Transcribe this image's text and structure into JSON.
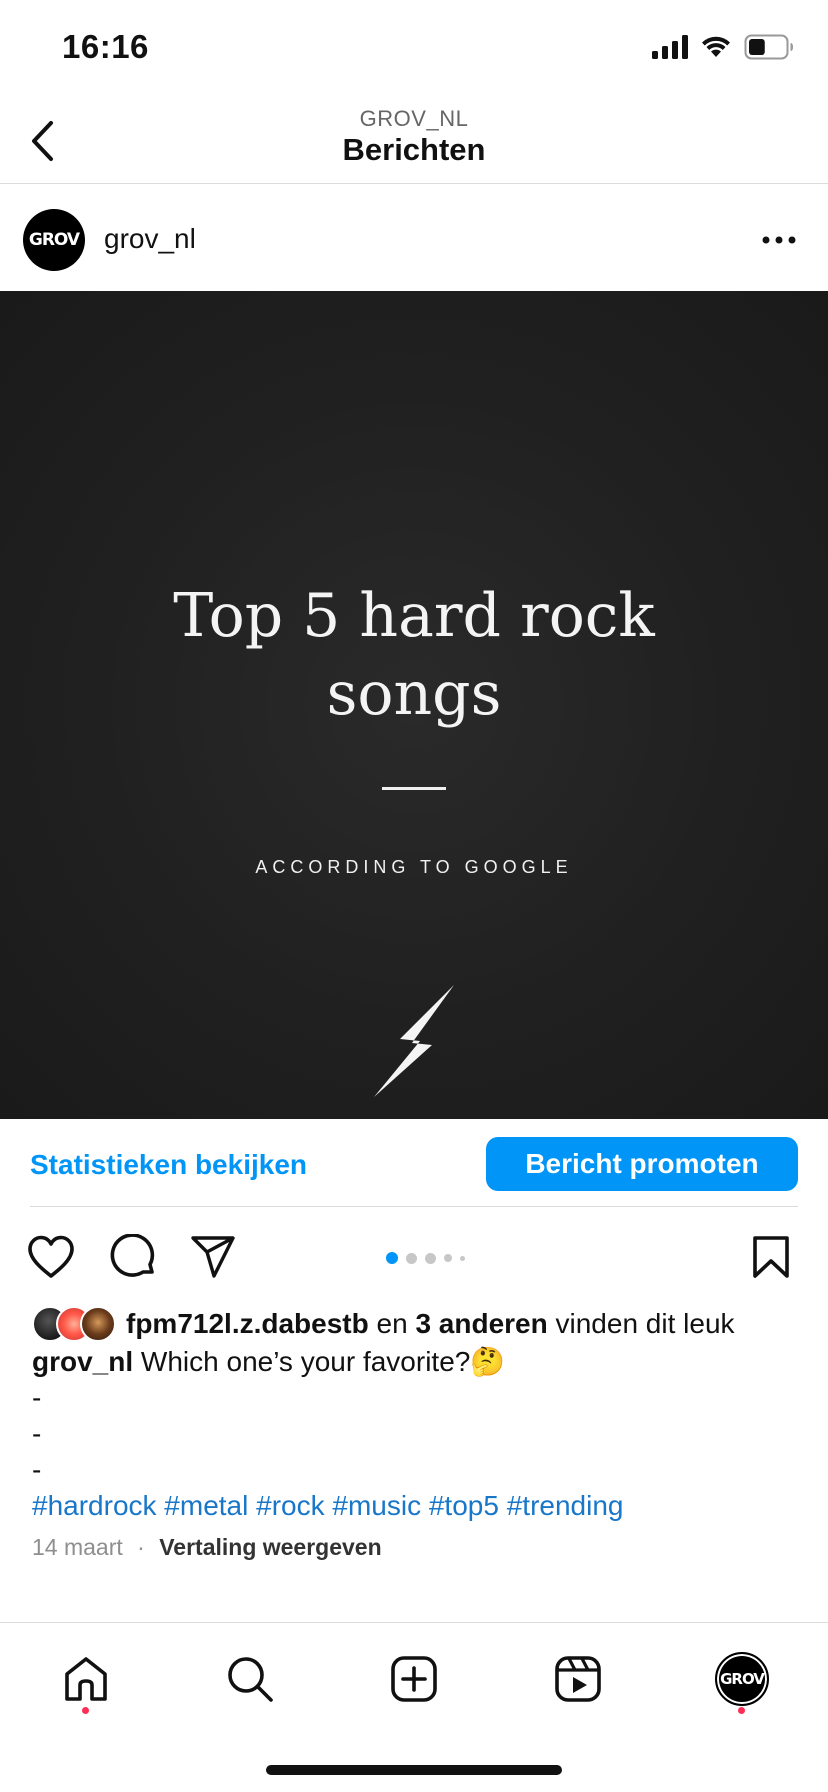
{
  "status_bar": {
    "time": "16:16",
    "icons": [
      "cellular-signal-icon",
      "wifi-icon",
      "battery-icon"
    ],
    "battery_level": 0.45
  },
  "header": {
    "subtitle": "GROV_NL",
    "title": "Berichten",
    "back_icon": "chevron-left-icon"
  },
  "post": {
    "avatar_text": "GROV",
    "username": "grov_nl",
    "more_icon": "more-horizontal-icon",
    "image": {
      "title_line1": "Top 5 hard rock",
      "title_line2": "songs",
      "subtitle": "ACCORDING TO GOOGLE",
      "icon": "lightning-bolt-icon"
    },
    "stats_link": "Statistieken bekijken",
    "promote_button": "Bericht promoten",
    "carousel": {
      "count": 5,
      "active_index": 0
    },
    "likes": {
      "first_liker": "fpm712l.z.dabestb",
      "connector": "en",
      "others": "3 anderen",
      "suffix": "vinden dit leuk"
    },
    "caption": {
      "username": "grov_nl",
      "text": "Which one’s your favorite?🤔",
      "dashes": [
        "-",
        "-",
        "-"
      ],
      "hashtags": [
        "#hardrock",
        "#metal",
        "#rock",
        "#music",
        "#top5",
        "#trending"
      ]
    },
    "date": "14 maart",
    "separator": "·",
    "translate_link": "Vertaling weergeven"
  },
  "tab_bar": {
    "tabs": [
      "home-icon",
      "search-icon",
      "create-icon",
      "reels-icon",
      "profile-avatar"
    ],
    "profile_avatar_text": "GROV",
    "accent": "#ff2d55"
  },
  "colors": {
    "accent_blue": "#0095f6",
    "hashtag_blue": "#1877c9",
    "image_bg": "#222222"
  }
}
